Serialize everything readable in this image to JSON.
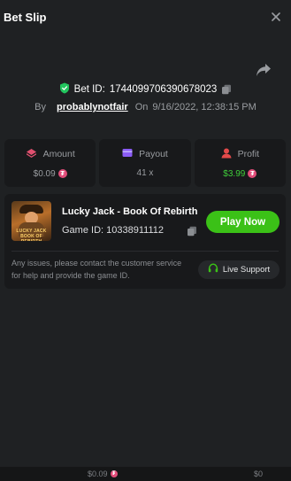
{
  "header": {
    "title": "Bet Slip",
    "close_icon": "close-icon"
  },
  "bet": {
    "id_label": "Bet ID:",
    "id_value": "1744099706390678023",
    "by_label": "By",
    "username": "probablynotfair",
    "on_label": "On",
    "datetime": "9/16/2022, 12:38:15 PM"
  },
  "stats": {
    "amount": {
      "label": "Amount",
      "value": "$0.09",
      "icon": "coins-icon"
    },
    "payout": {
      "label": "Payout",
      "value": "41 x",
      "icon": "wallet-icon"
    },
    "profit": {
      "label": "Profit",
      "value": "$3.99",
      "icon": "profit-icon"
    }
  },
  "game": {
    "title": "Lucky Jack - Book Of Rebirth",
    "id_label": "Game ID:",
    "id_value": "10338911112",
    "thumb_caption_1": "LUCKY JACK",
    "thumb_caption_2": "BOOK OF REBIRTH",
    "play_label": "Play Now",
    "note": "Any issues, please contact the customer service for help and provide the game ID.",
    "support_label": "Live Support"
  },
  "footer": {
    "value_left": "$0.09",
    "value_right": "$0"
  },
  "colors": {
    "background": "#1f2123",
    "card": "#18191b",
    "accent_green": "#3bc117",
    "profit_green": "#3fce3a",
    "coin_pink": "#e24d7a",
    "amount_icon": "#e0506f",
    "payout_icon": "#8b5cf6",
    "profit_icon": "#e24a4a",
    "verified_green": "#22c55e"
  }
}
